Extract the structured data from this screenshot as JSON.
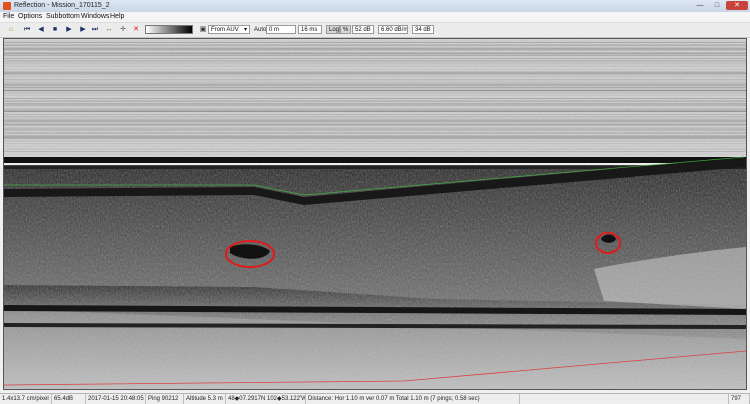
{
  "window": {
    "title": "Reflection - Mission_170115_2",
    "min_icon": "—",
    "max_icon": "□",
    "close_icon": "✕"
  },
  "menu": [
    "File",
    "Options",
    "Subbottom",
    "Windows",
    "Help"
  ],
  "toolbar": {
    "icons": [
      "folder-open-icon",
      "skip-back-icon",
      "step-back-icon",
      "stop-icon",
      "play-icon",
      "step-forward-icon",
      "skip-forward-icon",
      "ruler-icon",
      "crosshair-icon",
      "delete-icon"
    ],
    "glyphs": [
      "⌂",
      "⏮",
      "◀",
      "■",
      "▶",
      "▶",
      "⏭",
      "↔",
      "✛",
      "✕"
    ],
    "display_mode": "From AUV",
    "auto_label": "Auto",
    "auto_value": "0 m",
    "range_value": "16 ms",
    "log_label": "Log",
    "log_suffix": "%",
    "gain_value": "52 dB",
    "tvg_value": "6.60 dB/ms",
    "end_value": "34 dB"
  },
  "status": {
    "resolution": "1.4x13.7 cm/pixel",
    "depth": "65.4dB",
    "datetime": "2017-01-15 20:48:05",
    "ping": "Ping 90212",
    "altitude": "Altitude 5.3 m",
    "position": "48◆07.2917N 102◆53.122'W",
    "distance": "Distance: Hor 1.10 m ver 0.07 m Total 1.10 m (7 pings; 0.58 sec)",
    "count": "797"
  },
  "colors": {
    "bottom_trace": "#3fbf3f",
    "annotation": "#e11b1b",
    "seafloor_line": "#d94040"
  }
}
